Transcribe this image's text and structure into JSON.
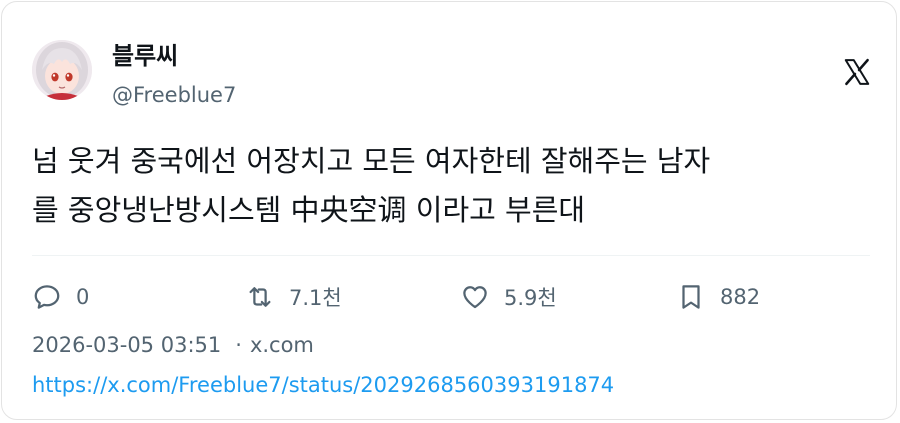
{
  "author": {
    "display_name": "블루씨",
    "handle": "@Freeblue7",
    "avatar_icon": "anime-character-avatar"
  },
  "brand": {
    "logo_icon": "x-logo-icon",
    "color": "#0f1419"
  },
  "tweet": {
    "lines": [
      "넘 웃겨 중국에선 어장치고 모든 여자한테 잘해주는 남자",
      "를 중앙냉난방시스템 中央空调 이라고 부른대"
    ]
  },
  "actions": {
    "reply": {
      "icon": "reply-icon",
      "count": "0"
    },
    "repost": {
      "icon": "repost-icon",
      "count": "7.1천"
    },
    "like": {
      "icon": "heart-icon",
      "count": "5.9천"
    },
    "bookmark": {
      "icon": "bookmark-icon",
      "count": "882"
    }
  },
  "meta": {
    "timestamp": "2026-03-05 03:51",
    "separator": "·",
    "source": "x.com"
  },
  "link": {
    "url": "https://x.com/Freeblue7/status/2029268560393191874"
  },
  "colors": {
    "text_primary": "#0f1419",
    "text_secondary": "#536471",
    "link": "#1d9bf0",
    "border": "#e3e3e3"
  }
}
